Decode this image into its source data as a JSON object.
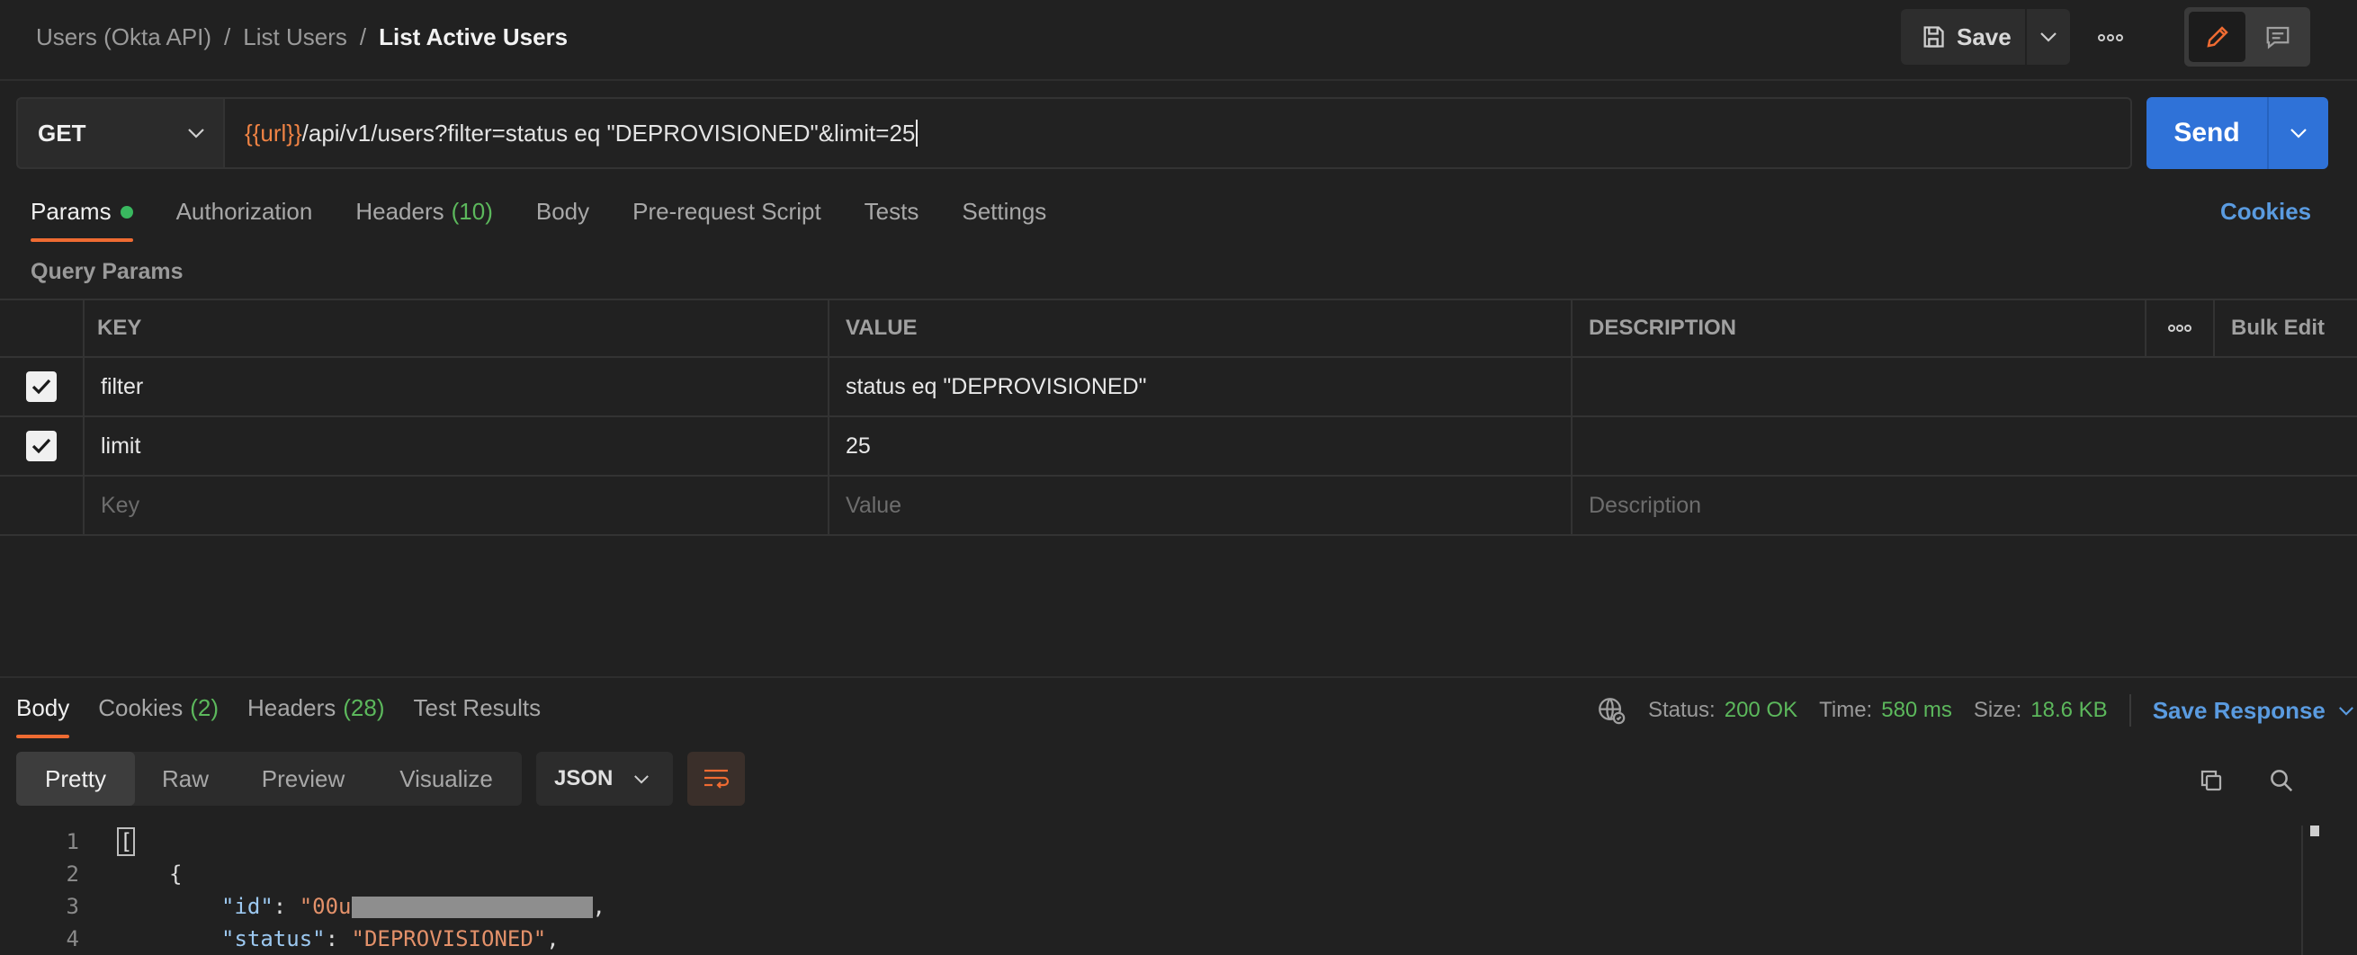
{
  "breadcrumb": {
    "items": [
      "Users (Okta API)",
      "List Users"
    ],
    "separator": "/",
    "current": "List Active Users"
  },
  "toolbar": {
    "save_label": "Save",
    "save_icon": "floppy-disk-icon",
    "more_icon": "ellipsis-icon",
    "edit_icon": "pencil-icon",
    "comment_icon": "comment-icon"
  },
  "request": {
    "method": "GET",
    "url_variable": "{{url}}",
    "url_path": "/api/v1/users?filter=status eq \"DEPROVISIONED\"&limit=25",
    "send_label": "Send"
  },
  "request_tabs": [
    {
      "label": "Params",
      "count": "",
      "active": true,
      "has_dot": true
    },
    {
      "label": "Authorization",
      "count": ""
    },
    {
      "label": "Headers",
      "count": "(10)"
    },
    {
      "label": "Body",
      "count": ""
    },
    {
      "label": "Pre-request Script",
      "count": ""
    },
    {
      "label": "Tests",
      "count": ""
    },
    {
      "label": "Settings",
      "count": ""
    }
  ],
  "cookies_link": "Cookies",
  "query_params": {
    "title": "Query Params",
    "columns": {
      "key": "KEY",
      "value": "VALUE",
      "description": "DESCRIPTION",
      "bulk_edit": "Bulk Edit"
    },
    "rows": [
      {
        "key": "filter",
        "value": "status eq \"DEPROVISIONED\"",
        "description": "",
        "checked": true
      },
      {
        "key": "limit",
        "value": "25",
        "description": "",
        "checked": true
      }
    ],
    "placeholder": {
      "key": "Key",
      "value": "Value",
      "description": "Description"
    }
  },
  "response": {
    "tabs": [
      {
        "label": "Body",
        "count": "",
        "active": true
      },
      {
        "label": "Cookies",
        "count": "(2)"
      },
      {
        "label": "Headers",
        "count": "(28)"
      },
      {
        "label": "Test Results",
        "count": ""
      }
    ],
    "status_label": "Status:",
    "status_value": "200 OK",
    "time_label": "Time:",
    "time_value": "580 ms",
    "size_label": "Size:",
    "size_value": "18.6 KB",
    "save_response": "Save Response",
    "view_modes": [
      "Pretty",
      "Raw",
      "Preview",
      "Visualize"
    ],
    "active_view": "Pretty",
    "format": "JSON",
    "code_lines": [
      {
        "n": "1",
        "text": "["
      },
      {
        "n": "2",
        "text": "{"
      },
      {
        "n": "3",
        "key": "\"id\"",
        "value": "\"00u"
      },
      {
        "n": "4",
        "key": "\"status\"",
        "value": "\"DEPROVISIONED\""
      }
    ]
  },
  "colors": {
    "accent": "#ef6b32",
    "send": "#2f72d8",
    "link": "#5a9be0",
    "success": "#5cb85c"
  }
}
